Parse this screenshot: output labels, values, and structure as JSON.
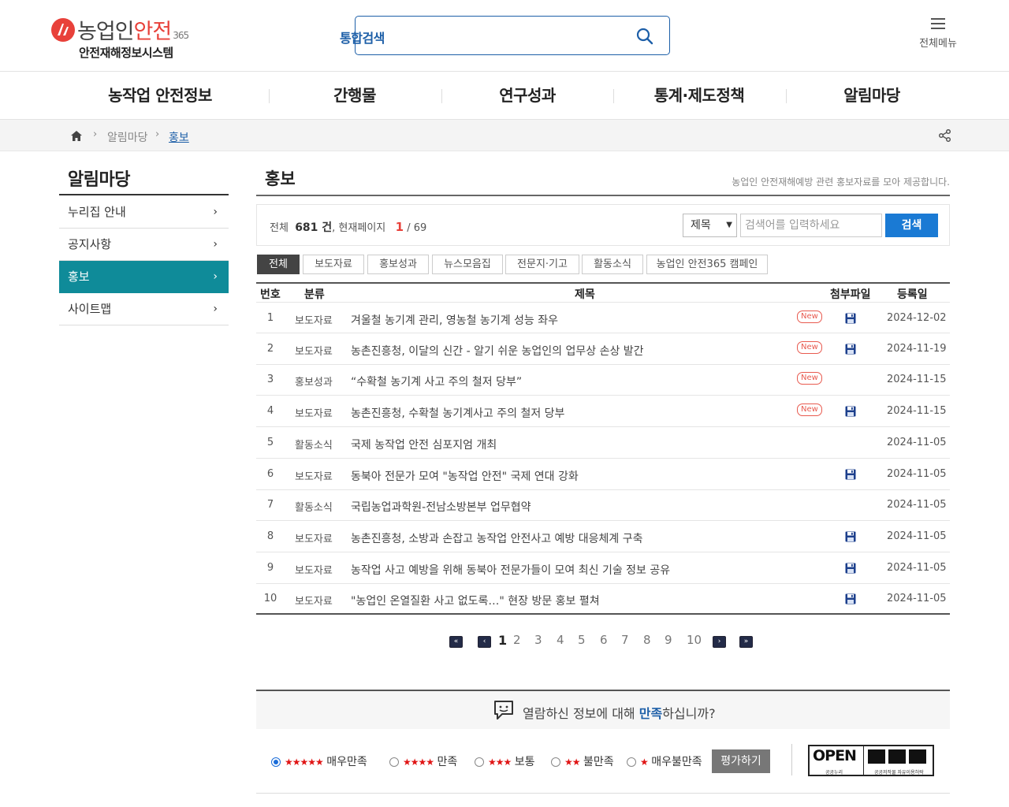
{
  "header": {
    "logo_main_1": "농업인",
    "logo_main_2": "안전",
    "logo_365": "365",
    "logo_sub": "안전재해정보시스템",
    "search_label": "통합검색",
    "allmenu_label": "전체메뉴"
  },
  "gnb": [
    "농작업 안전정보",
    "간행물",
    "연구성과",
    "통계·제도정책",
    "알림마당"
  ],
  "breadcrumb": {
    "parent": "알림마당",
    "current": "홍보"
  },
  "sidebar": {
    "title": "알림마당",
    "items": [
      {
        "label": "누리집 안내",
        "active": false
      },
      {
        "label": "공지사항",
        "active": false
      },
      {
        "label": "홍보",
        "active": true
      },
      {
        "label": "사이트맵",
        "active": false
      }
    ]
  },
  "content": {
    "title": "홍보",
    "desc": "농업인 안전재해예방 관련 홍보자료를 모아 제공합니다.",
    "stat_total_label": "전체",
    "stat_total": "681 건",
    "stat_page_label": ", 현재페이지",
    "stat_cur_page": "1",
    "stat_total_pages": "/ 69",
    "search_select": "제목",
    "search_placeholder": "검색어를 입력하세요",
    "search_button": "검색"
  },
  "tabs": [
    "전체",
    "보도자료",
    "홍보성과",
    "뉴스모음집",
    "전문지·기고",
    "활동소식",
    "농업인 안전365 캠페인"
  ],
  "table": {
    "headers": [
      "번호",
      "분류",
      "제목",
      "첨부파일",
      "등록일"
    ],
    "rows": [
      {
        "no": "1",
        "cat": "보도자료",
        "title": "겨울철 농기계 관리, 영농철 농기계 성능 좌우",
        "new": "New",
        "file": true,
        "date": "2024-12-02"
      },
      {
        "no": "2",
        "cat": "보도자료",
        "title": "농촌진흥청, 이달의 신간 - 알기 쉬운 농업인의 업무상 손상 발간",
        "new": "New",
        "file": true,
        "date": "2024-11-19"
      },
      {
        "no": "3",
        "cat": "홍보성과",
        "title": "“수확철 농기계 사고 주의 철저 당부”",
        "new": "New",
        "file": false,
        "date": "2024-11-15"
      },
      {
        "no": "4",
        "cat": "보도자료",
        "title": "농촌진흥청, 수확철 농기계사고 주의 철저 당부",
        "new": "New",
        "file": true,
        "date": "2024-11-15"
      },
      {
        "no": "5",
        "cat": "활동소식",
        "title": "국제 농작업 안전 심포지엄 개최",
        "new": "",
        "file": false,
        "date": "2024-11-05"
      },
      {
        "no": "6",
        "cat": "보도자료",
        "title": "동북아 전문가 모여 \"농작업 안전\" 국제 연대 강화",
        "new": "",
        "file": true,
        "date": "2024-11-05"
      },
      {
        "no": "7",
        "cat": "활동소식",
        "title": "국립농업과학원-전남소방본부 업무협약",
        "new": "",
        "file": false,
        "date": "2024-11-05"
      },
      {
        "no": "8",
        "cat": "보도자료",
        "title": "농촌진흥청, 소방과 손잡고 농작업 안전사고 예방 대응체계 구축",
        "new": "",
        "file": true,
        "date": "2024-11-05"
      },
      {
        "no": "9",
        "cat": "보도자료",
        "title": "농작업 사고 예방을 위해 동북아 전문가들이 모여 최신 기술 정보 공유",
        "new": "",
        "file": true,
        "date": "2024-11-05"
      },
      {
        "no": "10",
        "cat": "보도자료",
        "title": "\"농업인 온열질환 사고 없도록…\" 현장 방문 홍보 펼쳐",
        "new": "",
        "file": true,
        "date": "2024-11-05"
      }
    ]
  },
  "pager": {
    "pages": [
      "1",
      "2",
      "3",
      "4",
      "5",
      "6",
      "7",
      "8",
      "9",
      "10"
    ],
    "current": "1"
  },
  "survey": {
    "q_pre": "열람하신 정보에 대해 ",
    "q_hl": "만족",
    "q_post": "하십니까?",
    "options": [
      {
        "label": "매우만족",
        "stars": "★★★★★",
        "checked": true
      },
      {
        "label": "만족",
        "stars": "★★★★",
        "checked": false
      },
      {
        "label": "보통",
        "stars": "★★★",
        "checked": false
      },
      {
        "label": "불만족",
        "stars": "★★",
        "checked": false
      },
      {
        "label": "매우불만족",
        "stars": "★",
        "checked": false
      }
    ],
    "submit": "평가하기"
  },
  "open_badge": {
    "text": "OPEN",
    "sub1": "공공누리",
    "sub2": "공공저작물 자유이용허락"
  },
  "colors": {
    "accent": "#1d5fa8",
    "sidebar_active": "#0f8b99",
    "button": "#1a7ad4",
    "red": "#e8413a"
  }
}
